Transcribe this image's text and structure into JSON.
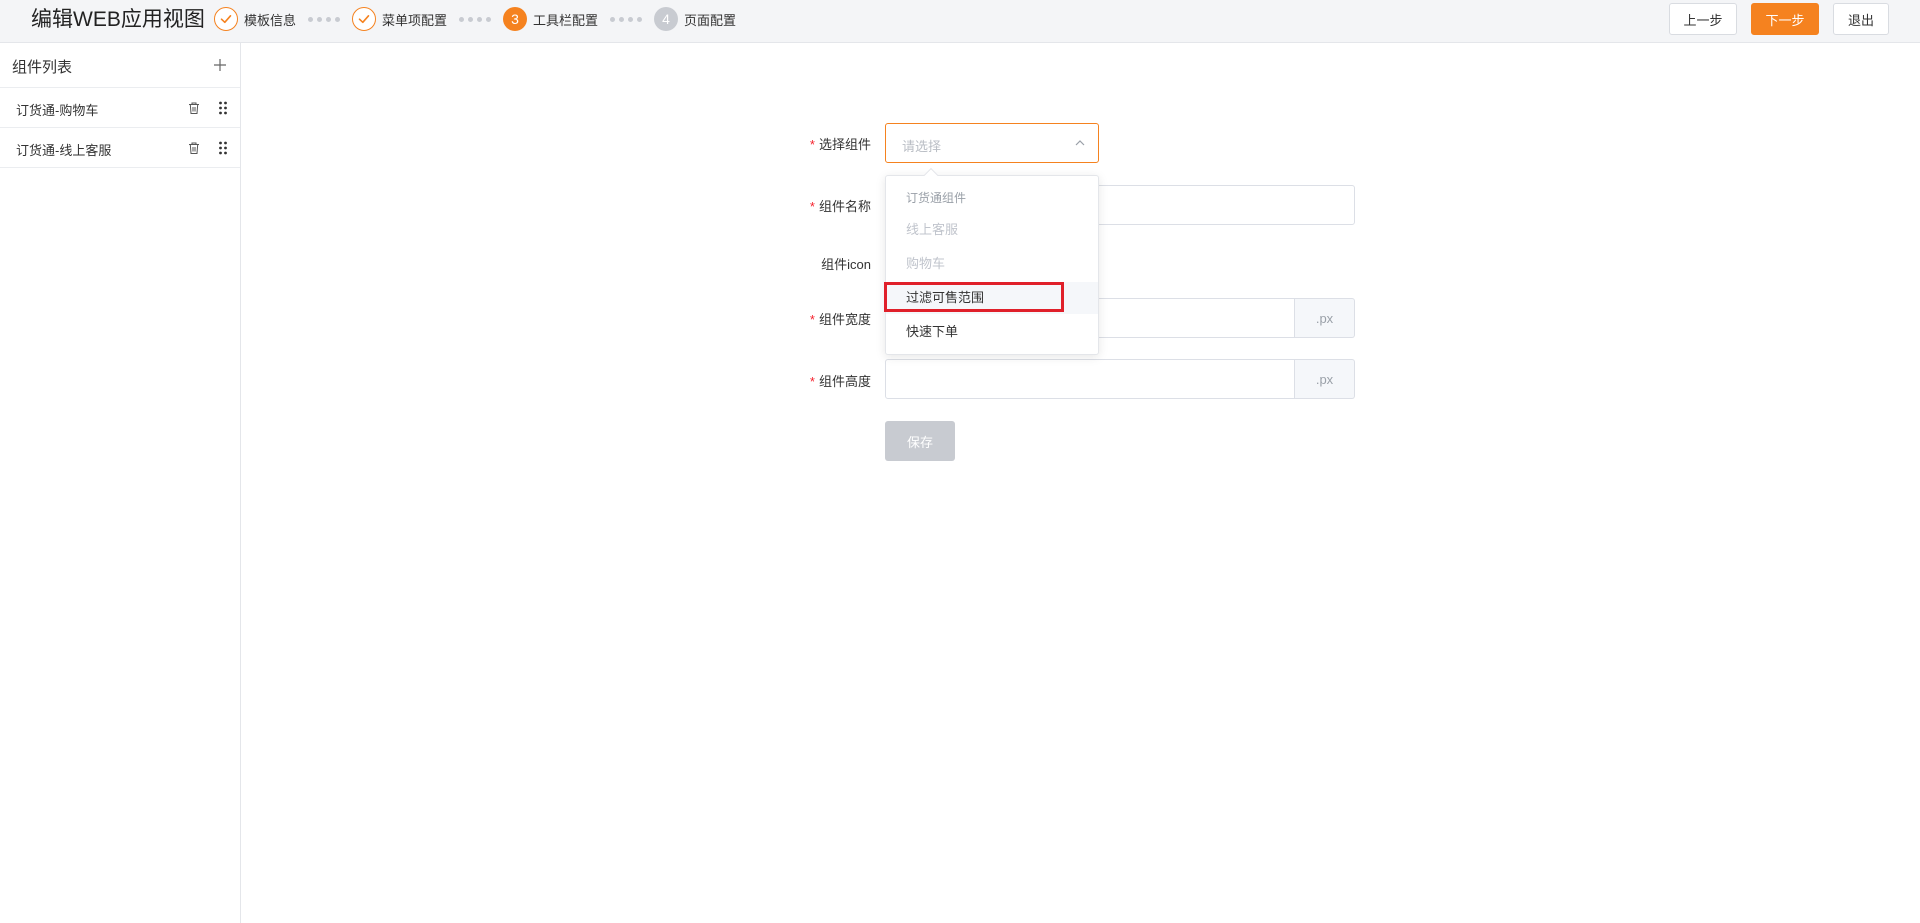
{
  "header": {
    "title": "编辑WEB应用视图",
    "steps": [
      {
        "number": "1",
        "label": "模板信息",
        "state": "done"
      },
      {
        "number": "2",
        "label": "菜单项配置",
        "state": "done"
      },
      {
        "number": "3",
        "label": "工具栏配置",
        "state": "active"
      },
      {
        "number": "4",
        "label": "页面配置",
        "state": "pending"
      }
    ],
    "prev_label": "上一步",
    "next_label": "下一步",
    "exit_label": "退出"
  },
  "sidebar": {
    "title": "组件列表",
    "items": [
      {
        "label": "订货通-购物车"
      },
      {
        "label": "订货通-线上客服"
      }
    ]
  },
  "form": {
    "select_component_label": "选择组件",
    "select_placeholder": "请选择",
    "component_name_label": "组件名称",
    "component_icon_label": "组件icon",
    "component_width_label": "组件宽度",
    "component_height_label": "组件高度",
    "unit_suffix": ".px",
    "save_label": "保存"
  },
  "dropdown": {
    "group_title": "订货通组件",
    "options": [
      {
        "label": "线上客服",
        "state": "disabled"
      },
      {
        "label": "购物车",
        "state": "disabled"
      },
      {
        "label": "过滤可售范围",
        "state": "hover"
      },
      {
        "label": "快速下单",
        "state": "normal"
      }
    ]
  },
  "colors": {
    "accent": "#f5821f",
    "required": "#f5222d",
    "highlight": "#e0202a",
    "disabled_button": "#c8cbd1"
  }
}
